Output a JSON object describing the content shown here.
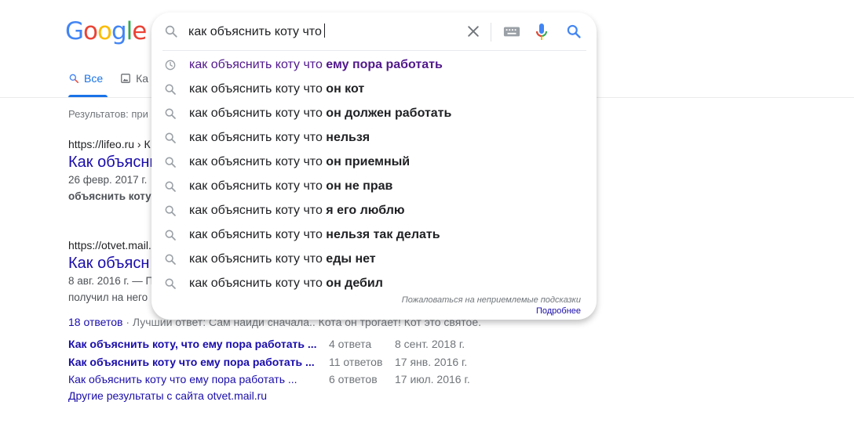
{
  "logo": {
    "text": "Google"
  },
  "search": {
    "query": "как объяснить коту что",
    "report_text": "Пожаловаться на неприемлемые подсказки",
    "more_link": "Подробнее"
  },
  "suggestions": [
    {
      "prefix": "как объяснить коту что",
      "suffix": " ему пора работать",
      "type": "history"
    },
    {
      "prefix": "как объяснить коту что",
      "suffix": " он кот",
      "type": "search"
    },
    {
      "prefix": "как объяснить коту что",
      "suffix": " он должен работать",
      "type": "search"
    },
    {
      "prefix": "как объяснить коту что",
      "suffix": " нельзя",
      "type": "search"
    },
    {
      "prefix": "как объяснить коту что",
      "suffix": " он приемный",
      "type": "search"
    },
    {
      "prefix": "как объяснить коту что",
      "suffix": " он не прав",
      "type": "search"
    },
    {
      "prefix": "как объяснить коту что",
      "suffix": " я его люблю",
      "type": "search"
    },
    {
      "prefix": "как объяснить коту что",
      "suffix": " нельзя так делать",
      "type": "search"
    },
    {
      "prefix": "как объяснить коту что",
      "suffix": " еды нет",
      "type": "search"
    },
    {
      "prefix": "как объяснить коту что",
      "suffix": " он дебил",
      "type": "search"
    }
  ],
  "tabs": [
    {
      "label": "Все"
    },
    {
      "label": "Ка"
    }
  ],
  "stats": "Результатов: при",
  "results": [
    {
      "url": "https://lifeo.ru › К",
      "title": "Как объясни",
      "date": "26 февр. 2017 г.",
      "snippet_bold": "объяснить коту"
    },
    {
      "url": "https://otvet.mail.",
      "title": "Как объясн",
      "date": "8 авг. 2016 г. — П",
      "snippet": "получил на него"
    }
  ],
  "answers": {
    "count": "18 ответов",
    "sep": " · ",
    "rest": "Лучший ответ: Сам найди сначала.. Кота он трогает! Кот это святое."
  },
  "related": [
    {
      "title": "Как объяснить коту, что ему пора работать ...",
      "answers": "4 ответа",
      "date": "8 сент. 2018 г."
    },
    {
      "title": "Как объяснить коту что ему пора работать ...",
      "answers": "11 ответов",
      "date": "17 янв. 2016 г."
    },
    {
      "title": "Как объяснить коту что ему пора работать ...",
      "answers": "6 ответов",
      "date": "17 июл. 2016 г."
    }
  ],
  "more_results": "Другие результаты с сайта otvet.mail.ru",
  "colors": {
    "link": "#1a0dab",
    "history": "#52188c",
    "accent": "#1a73e8"
  }
}
